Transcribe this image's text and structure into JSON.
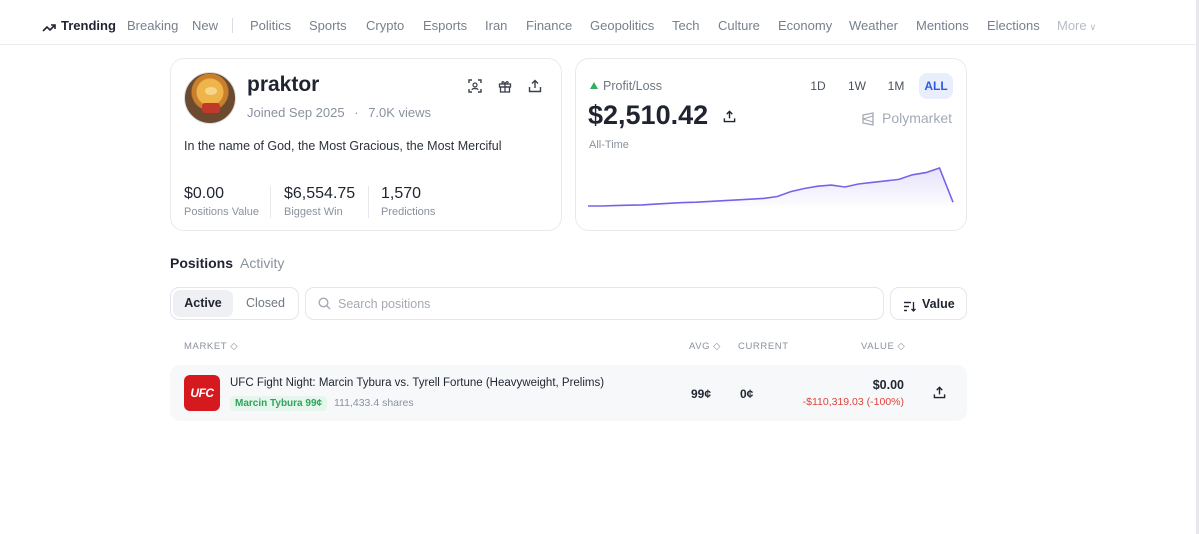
{
  "nav": {
    "items": [
      "Trending",
      "Breaking",
      "New",
      "Politics",
      "Sports",
      "Crypto",
      "Esports",
      "Iran",
      "Finance",
      "Geopolitics",
      "Tech",
      "Culture",
      "Economy",
      "Weather",
      "Mentions",
      "Elections"
    ],
    "more_label": "More",
    "active": "Trending"
  },
  "profile": {
    "username": "praktor",
    "joined": "Joined Sep 2025",
    "views": "7.0K views",
    "bio": "In the name of God, the Most Gracious, the Most Merciful",
    "stats": [
      {
        "value": "$0.00",
        "label": "Positions Value"
      },
      {
        "value": "$6,554.75",
        "label": "Biggest Win"
      },
      {
        "value": "1,570",
        "label": "Predictions"
      }
    ]
  },
  "pnl": {
    "label": "Profit/Loss",
    "value": "$2,510.42",
    "period": "All-Time",
    "brand": "Polymarket",
    "ranges": [
      "1D",
      "1W",
      "1M",
      "ALL"
    ],
    "active_range": "ALL",
    "positive_color": "#2fb05e",
    "line_color": "#7b61e8",
    "chart_data": {
      "type": "area",
      "series": [
        {
          "values": [
            0,
            0,
            1,
            2,
            3,
            5,
            7,
            9,
            10,
            12,
            14,
            16,
            18,
            20,
            25,
            38,
            46,
            52,
            55,
            50,
            58,
            62,
            66,
            70,
            82,
            88,
            100,
            10
          ]
        }
      ]
    }
  },
  "tabs": {
    "positions": "Positions",
    "activity": "Activity"
  },
  "filter": {
    "active": "Active",
    "closed": "Closed"
  },
  "search": {
    "placeholder": "Search positions"
  },
  "sort": {
    "label": "Value"
  },
  "table": {
    "headers": {
      "market": "MARKET",
      "avg": "AVG",
      "current": "CURRENT",
      "value": "VALUE"
    },
    "rows": [
      {
        "logo": "UFC",
        "title": "UFC Fight Night: Marcin Tybura vs. Tyrell Fortune (Heavyweight, Prelims)",
        "outcome": "Marcin Tybura 99¢",
        "shares": "111,433.4 shares",
        "avg": "99¢",
        "current": "0¢",
        "value": "$0.00",
        "change": "-$110,319.03 (-100%)"
      }
    ]
  }
}
